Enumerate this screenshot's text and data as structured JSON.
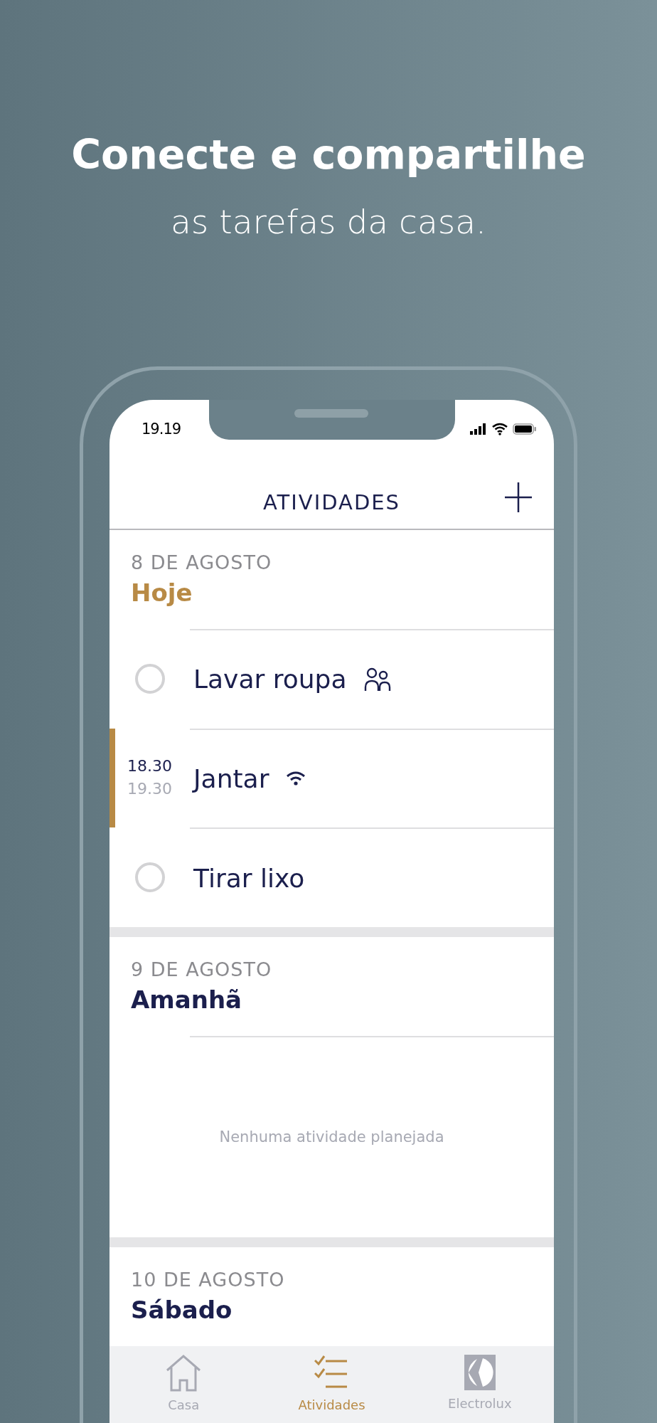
{
  "headline": {
    "title": "Conecte e compartilhe",
    "subtitle": "as tarefas da casa."
  },
  "status_bar": {
    "time": "19.19"
  },
  "header": {
    "title": "ATIVIDADES"
  },
  "sections": [
    {
      "date": "8 DE AGOSTO",
      "day": "Hoje",
      "today": true,
      "items": [
        {
          "kind": "shared",
          "title": "Lavar roupa",
          "checked": false
        },
        {
          "kind": "event",
          "title": "Jantar",
          "start": "18.30",
          "end": "19.30"
        },
        {
          "kind": "task",
          "title": "Tirar lixo",
          "checked": false
        }
      ]
    },
    {
      "date": "9 DE AGOSTO",
      "day": "Amanhã",
      "today": false,
      "empty_text": "Nenhuma atividade planejada"
    },
    {
      "date": "10 DE AGOSTO",
      "day": "Sábado",
      "today": false
    }
  ],
  "tab_bar": [
    {
      "label": "Casa",
      "selected": false
    },
    {
      "label": "Atividades",
      "selected": true
    },
    {
      "label": "Electrolux",
      "selected": false
    }
  ]
}
